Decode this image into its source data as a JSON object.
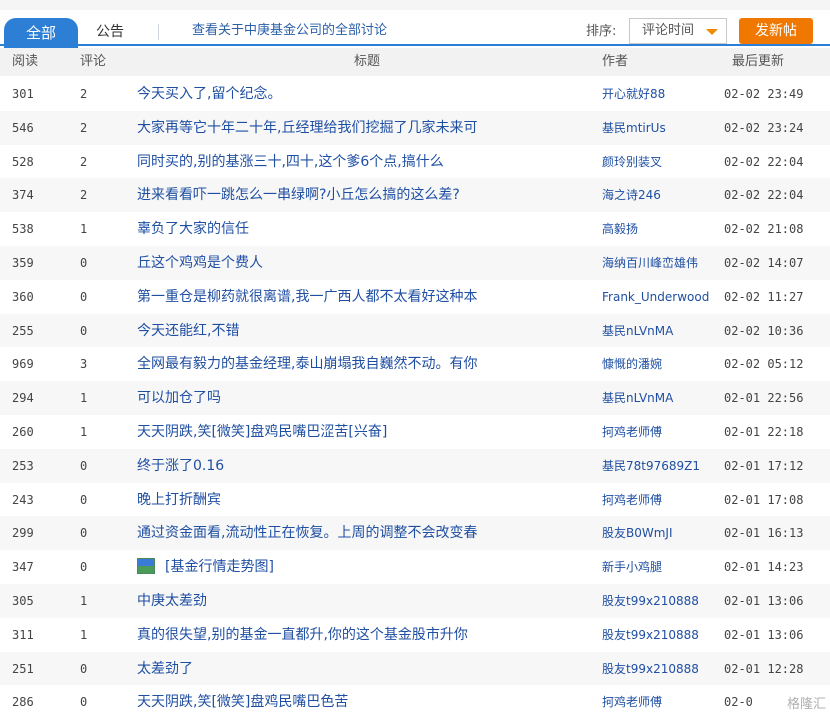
{
  "tabs": {
    "all": "全部",
    "notice": "公告",
    "discuss": "查看关于中庚基金公司的全部讨论"
  },
  "sort": {
    "label": "排序:",
    "selected": "评论时间"
  },
  "post_button": "发新帖",
  "columns": {
    "read": "阅读",
    "comment": "评论",
    "title": "标题",
    "author": "作者",
    "updated": "最后更新"
  },
  "rows": [
    {
      "read": "301",
      "comment": "2",
      "title": "今天买入了,留个纪念。",
      "author": "开心就好88",
      "time": "02-02 23:49"
    },
    {
      "read": "546",
      "comment": "2",
      "title": "大家再等它十年二十年,丘经理给我们挖掘了几家未来可",
      "author": "基民mtirUs",
      "time": "02-02 23:24"
    },
    {
      "read": "528",
      "comment": "2",
      "title": "同时买的,别的基涨三十,四十,这个爹6个点,搞什么",
      "author": "颜玲别装叉",
      "time": "02-02 22:04"
    },
    {
      "read": "374",
      "comment": "2",
      "title": "进来看看吓一跳怎么一串绿啊?小丘怎么搞的这么差?",
      "author": "海之诗246",
      "time": "02-02 22:04"
    },
    {
      "read": "538",
      "comment": "1",
      "title": "辜负了大家的信任",
      "author": "高毅扬",
      "time": "02-02 21:08"
    },
    {
      "read": "359",
      "comment": "0",
      "title": "丘这个鸡鸡是个费人",
      "author": "海纳百川峰峦雄伟",
      "time": "02-02 14:07"
    },
    {
      "read": "360",
      "comment": "0",
      "title": "第一重仓是柳药就很离谱,我一广西人都不太看好这种本",
      "author": "Frank_Underwood",
      "time": "02-02 11:27"
    },
    {
      "read": "255",
      "comment": "0",
      "title": "今天还能红,不错",
      "author": "基民nLVnMA",
      "time": "02-02 10:36"
    },
    {
      "read": "969",
      "comment": "3",
      "title": "全网最有毅力的基金经理,泰山崩塌我自巍然不动。有你",
      "author": "慷慨的潘婉",
      "time": "02-02 05:12"
    },
    {
      "read": "294",
      "comment": "1",
      "title": "可以加仓了吗",
      "author": "基民nLVnMA",
      "time": "02-01 22:56"
    },
    {
      "read": "260",
      "comment": "1",
      "title": "天天阴跌,笑[微笑]盘鸡民嘴巴涩苦[兴奋]",
      "author": "抲鸡老师傅",
      "time": "02-01 22:18"
    },
    {
      "read": "253",
      "comment": "0",
      "title": "终于涨了0.16",
      "author": "基民78t97689Z1",
      "time": "02-01 17:12"
    },
    {
      "read": "243",
      "comment": "0",
      "title": "晚上打折酬宾",
      "author": "抲鸡老师傅",
      "time": "02-01 17:08"
    },
    {
      "read": "299",
      "comment": "0",
      "title": "通过资金面看,流动性正在恢复。上周的调整不会改变春",
      "author": "股友B0WmJI",
      "time": "02-01 16:13"
    },
    {
      "read": "347",
      "comment": "0",
      "title": "[基金行情走势图]",
      "author": "新手小鸡腿",
      "time": "02-01 14:23",
      "image": true
    },
    {
      "read": "305",
      "comment": "1",
      "title": "中庚太差劲",
      "author": "股友t99x210888",
      "time": "02-01 13:06"
    },
    {
      "read": "311",
      "comment": "1",
      "title": "真的很失望,别的基金一直都升,你的这个基金股市升你",
      "author": "股友t99x210888",
      "time": "02-01 13:06"
    },
    {
      "read": "251",
      "comment": "0",
      "title": "太差劲了",
      "author": "股友t99x210888",
      "time": "02-01 12:28"
    },
    {
      "read": "286",
      "comment": "0",
      "title": "天天阴跌,笑[微笑]盘鸡民嘴巴色苦",
      "author": "抲鸡老师傅",
      "time": "02-0"
    }
  ],
  "watermark": "格隆汇"
}
